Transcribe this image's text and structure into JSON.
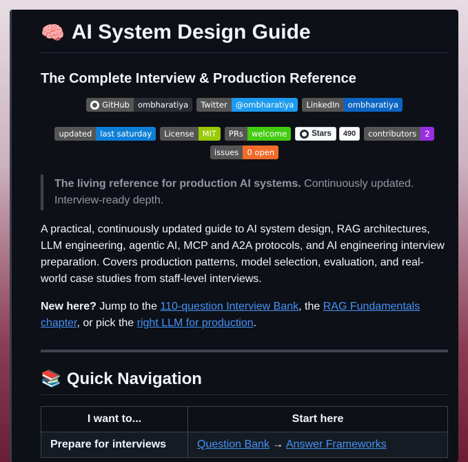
{
  "header": {
    "emoji": "🧠",
    "title": "AI System Design Guide",
    "subtitle": "The Complete Interview & Production Reference"
  },
  "badges_row1": [
    {
      "left": "GitHub",
      "right": "ombharatiya",
      "right_color": "#2b2f35",
      "icon": "github-icon"
    },
    {
      "left": "Twitter",
      "right": "@ombharatiya",
      "right_color": "#1d9bf0"
    },
    {
      "left": "LinkedIn",
      "right": "ombharatiya",
      "right_color": "#0a66c2"
    }
  ],
  "badges_row2": [
    {
      "left": "updated",
      "right": "last saturday",
      "right_color": "#0e7fd6"
    },
    {
      "left": "License",
      "right": "MIT",
      "right_color": "#97ca00"
    },
    {
      "left": "PRs",
      "right": "welcome",
      "right_color": "#44cc11"
    },
    {
      "left": "contributors",
      "right": "2",
      "right_color": "#9a2ce1"
    }
  ],
  "stars": {
    "label": "Stars",
    "count": "490",
    "icon": "github-icon"
  },
  "badges_row3": [
    {
      "left": "issues",
      "right": "0 open",
      "right_color": "#f36b2b"
    }
  ],
  "quote": {
    "bold": "The living reference for production AI systems.",
    "rest": " Continuously updated. Interview-ready depth."
  },
  "intro": "A practical, continuously updated guide to AI system design, RAG architectures, LLM engineering, agentic AI, MCP and A2A protocols, and AI engineering interview preparation. Covers production patterns, model selection, evaluation, and real-world case studies from staff-level interviews.",
  "newhere": {
    "bold": "New here?",
    "t1": " Jump to the ",
    "link1": "110-question Interview Bank",
    "t2": ", the ",
    "link2": "RAG Fundamentals chapter",
    "t3": ", or pick the ",
    "link3": "right LLM for production",
    "t4": "."
  },
  "quicknav": {
    "emoji": "📚",
    "title": "Quick Navigation",
    "col1": "I want to...",
    "col2": "Start here",
    "rows": [
      {
        "goal": "Prepare for interviews",
        "link1": "Question Bank",
        "arrow": "→",
        "link2": "Answer Frameworks"
      }
    ]
  }
}
